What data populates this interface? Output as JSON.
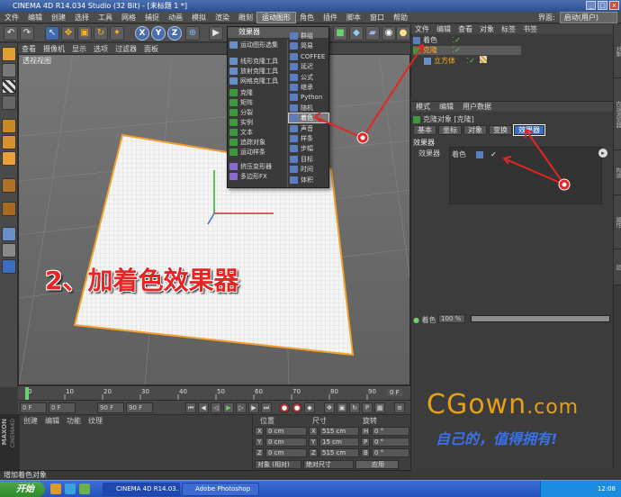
{
  "window": {
    "title": "CINEMA 4D R14.034 Studio (32 Bit) - [未标题 1 *]",
    "btn_min": "_",
    "btn_max": "□",
    "btn_close": "x"
  },
  "menubar": {
    "items": [
      "文件",
      "编辑",
      "创建",
      "选择",
      "工具",
      "网格",
      "捕捉",
      "动画",
      "模拟",
      "渲染",
      "雕刻",
      "运动图形",
      "角色",
      "插件",
      "脚本",
      "窗口",
      "帮助"
    ],
    "active_index": 11,
    "layout_label": "界面:",
    "layout_value": "启动(用户)"
  },
  "toolbar": {
    "icons": [
      "undo-icon",
      "redo-icon",
      "select-icon",
      "move-icon",
      "scale-icon",
      "rotate-icon",
      "live-icon",
      "x-axis-icon",
      "y-axis-icon",
      "z-axis-icon",
      "world-icon",
      "render-view-icon",
      "render-icon",
      "render-settings-icon"
    ],
    "axis_x": "X",
    "axis_y": "Y",
    "axis_z": "Z"
  },
  "viewport": {
    "menu": [
      "查看",
      "摄像机",
      "显示",
      "选项",
      "过滤器",
      "面板"
    ],
    "label": "透视视图"
  },
  "mograph_menu": {
    "header": "效果器",
    "items_left": [
      {
        "label": "运动图形选集",
        "color": "#6a8ec8"
      },
      {
        "label": "线形克隆工具",
        "color": "#6a8ec8"
      },
      {
        "label": "放射克隆工具",
        "color": "#6a8ec8"
      },
      {
        "label": "网格克隆工具",
        "color": "#6a8ec8"
      },
      {
        "label": "克隆",
        "color": "#3c9a3c"
      },
      {
        "label": "矩阵",
        "color": "#3c9a3c"
      },
      {
        "label": "分裂",
        "color": "#3c9a3c"
      },
      {
        "label": "实例",
        "color": "#3c9a3c"
      },
      {
        "label": "文本",
        "color": "#3c9a3c"
      },
      {
        "label": "追踪对象",
        "color": "#3c9a3c"
      },
      {
        "label": "运动样条",
        "color": "#3c9a3c"
      },
      {
        "label": "挤压变形器",
        "color": "#8a6ad0"
      },
      {
        "label": "多边形FX",
        "color": "#8a6ad0"
      }
    ],
    "items_right": [
      {
        "label": "群组",
        "color": "#5a7ec0"
      },
      {
        "label": "简易",
        "color": "#5a7ec0"
      },
      {
        "label": "COFFEE",
        "color": "#5a7ec0"
      },
      {
        "label": "延迟",
        "color": "#5a7ec0"
      },
      {
        "label": "公式",
        "color": "#5a7ec0"
      },
      {
        "label": "继承",
        "color": "#5a7ec0"
      },
      {
        "label": "Python",
        "color": "#5a7ec0"
      },
      {
        "label": "随机",
        "color": "#5a7ec0"
      },
      {
        "label": "着色",
        "color": "#5a7ec0"
      },
      {
        "label": "声音",
        "color": "#5a7ec0"
      },
      {
        "label": "样条",
        "color": "#5a7ec0"
      },
      {
        "label": "步幅",
        "color": "#5a7ec0"
      },
      {
        "label": "目标",
        "color": "#5a7ec0"
      },
      {
        "label": "时间",
        "color": "#5a7ec0"
      },
      {
        "label": "体积",
        "color": "#5a7ec0"
      }
    ],
    "highlight_index": 8
  },
  "object_manager": {
    "menu": [
      "文件",
      "编辑",
      "查看",
      "对象",
      "标签",
      "书签"
    ],
    "rows": [
      {
        "label": "着色",
        "indent": 0
      },
      {
        "label": "克隆",
        "indent": 0
      },
      {
        "label": "立方体",
        "indent": 1
      }
    ]
  },
  "attribute_manager": {
    "menu": [
      "模式",
      "编辑",
      "用户数据"
    ],
    "object_title": "克隆对象 [克隆]",
    "tabs": [
      "基本",
      "坐标",
      "对象",
      "变换",
      "效果器"
    ],
    "active_tab": 4,
    "section_title": "效果器",
    "field_label": "效果器",
    "field_value": "着色",
    "slider_label": "着色",
    "slider_value": "100 %"
  },
  "right_tabs": [
    "对象",
    "内容浏览器",
    "构造",
    "属性",
    "层"
  ],
  "timeline": {
    "ticks": [
      "0",
      "10",
      "20",
      "30",
      "40",
      "50",
      "60",
      "70",
      "80",
      "90"
    ],
    "end_label": "0 F",
    "start_field": "0 F",
    "cur_field": "0 F",
    "end_field": "90 F",
    "end_field2": "90 F"
  },
  "material_panel": {
    "menu": [
      "创建",
      "编辑",
      "功能",
      "纹理"
    ],
    "brand_line1": "MAXON",
    "brand_line2": "CINEMA4D"
  },
  "coord_panel": {
    "headers": [
      "位置",
      "尺寸",
      "旋转"
    ],
    "rows": [
      {
        "axis": "X",
        "pos": "0 cm",
        "size_axis": "X",
        "size": "515 cm",
        "rot_axis": "H",
        "rot": "0 °"
      },
      {
        "axis": "Y",
        "pos": "0 cm",
        "size_axis": "Y",
        "size": "15 cm",
        "rot_axis": "P",
        "rot": "0 °"
      },
      {
        "axis": "Z",
        "pos": "0 cm",
        "size_axis": "Z",
        "size": "515 cm",
        "rot_axis": "B",
        "rot": "0 °"
      }
    ],
    "mode1": "对象 (相对)",
    "mode2": "绝对尺寸",
    "apply": "应用"
  },
  "status_text": "增加着色对象",
  "overlay_text": "2、加着色效果器",
  "watermark": {
    "logo": "CGown",
    "logo_suffix": ".com",
    "slogan": "自己的，值得拥有!"
  },
  "taskbar": {
    "start": "开始",
    "tasks": [
      "CINEMA 4D R14.03...",
      "Adobe Photoshop"
    ],
    "clock": "12:08"
  },
  "colors": {
    "accent_blue": "#3a6fc0",
    "annotation_red": "#e52424",
    "plane_orange": "#f0a030",
    "logo_orange": "#e6a017",
    "slogan_blue": "#3a70e8"
  }
}
